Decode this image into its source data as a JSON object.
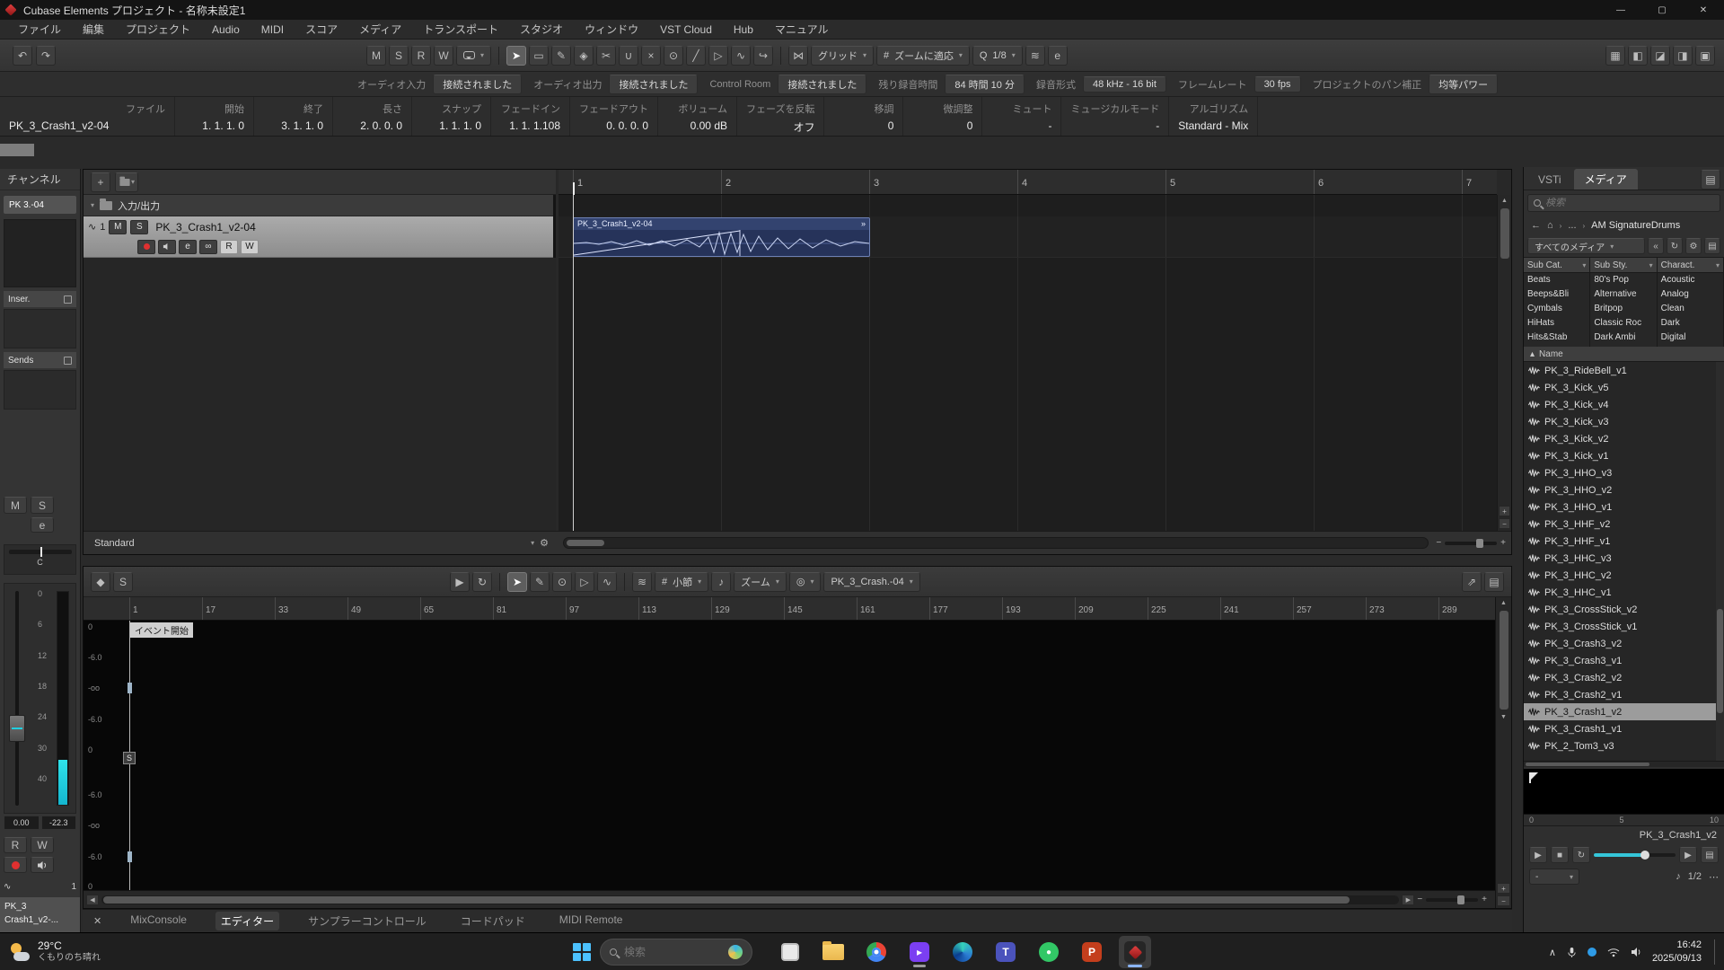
{
  "icons": {
    "caret": "▾",
    "up": "▲",
    "down": "▼",
    "left": "◀",
    "right": "▶",
    "plus": "+",
    "minus": "−",
    "undo": "↶",
    "redo": "↷",
    "close": "✕",
    "maximize": "▢",
    "minimize": "—",
    "back": "←",
    "chevron": "›",
    "ellipsis": "...",
    "home": "⌂",
    "gear": "⚙",
    "sort": "▴",
    "note": "♪",
    "play": "▶",
    "stop": "■",
    "loop": "↻",
    "menu": "▤",
    "dots": "⋯",
    "expand": "⇗",
    "grid": "▦",
    "eye": "◎",
    "hash": "#",
    "q": "Q",
    "iq": "≋",
    "e": "e",
    "pin": "◆",
    "snap": "⋈",
    "autoscroll": "↪",
    "chevup": "∧",
    "link": "∞",
    "wave": "∿",
    "rewind": "«",
    "refresh": "↻",
    "mode": "»"
  },
  "titlebar": {
    "title": "Cubase Elements プロジェクト - 名称未設定1",
    "minimize": "—",
    "maximize": "▢",
    "close": "✕"
  },
  "menubar": [
    "ファイル",
    "編集",
    "プロジェクト",
    "Audio",
    "MIDI",
    "スコア",
    "メディア",
    "トランスポート",
    "スタジオ",
    "ウィンドウ",
    "VST Cloud",
    "Hub",
    "マニュアル"
  ],
  "toolbar": {
    "state_buttons": [
      {
        "name": "mute-all-button",
        "glyph": "M"
      },
      {
        "name": "solo-all-button",
        "glyph": "S"
      },
      {
        "name": "read-automation-button",
        "glyph": "R"
      },
      {
        "name": "write-automation-button",
        "glyph": "W"
      }
    ],
    "tools": [
      {
        "name": "select-tool",
        "glyph": "➤",
        "active": true
      },
      {
        "name": "range-tool",
        "glyph": "▭"
      },
      {
        "name": "draw-tool",
        "glyph": "✎"
      },
      {
        "name": "erase-tool",
        "glyph": "◈"
      },
      {
        "name": "split-tool",
        "glyph": "✂"
      },
      {
        "name": "glue-tool",
        "glyph": "∪"
      },
      {
        "name": "mute-tool",
        "glyph": "×"
      },
      {
        "name": "zoom-tool",
        "glyph": "⊙"
      },
      {
        "name": "line-tool",
        "glyph": "╱"
      },
      {
        "name": "play-tool",
        "glyph": "▷"
      },
      {
        "name": "scrub-tool",
        "glyph": "∿"
      }
    ],
    "grid_dropdown": "グリッド",
    "grid_type_dropdown": "ズームに適応",
    "quantize_dropdown": "1/8",
    "right_icons": [
      {
        "name": "layout-grid-button",
        "glyph": "▦"
      },
      {
        "name": "left-zone-toggle",
        "glyph": "◧"
      },
      {
        "name": "lower-zone-toggle",
        "glyph": "◪"
      },
      {
        "name": "right-zone-toggle",
        "glyph": "◨"
      },
      {
        "name": "setup-layout-button",
        "glyph": "▣"
      }
    ]
  },
  "status_row": [
    {
      "label": "オーディオ入力",
      "value": "接続されました"
    },
    {
      "label": "オーディオ出力",
      "value": "接続されました"
    },
    {
      "label": "Control Room",
      "value": "接続されました"
    },
    {
      "label": "残り録音時間",
      "value": "84 時間 10 分"
    },
    {
      "label": "録音形式",
      "value": "48 kHz - 16 bit"
    },
    {
      "label": "フレームレート",
      "value": "30 fps"
    },
    {
      "label": "プロジェクトのパン補正",
      "value": "均等パワー"
    }
  ],
  "info_line": [
    {
      "label": "ファイル",
      "value": "PK_3_Crash1_v2-04"
    },
    {
      "label": "開始",
      "value": "1. 1. 1. 0"
    },
    {
      "label": "終了",
      "value": "3. 1. 1. 0"
    },
    {
      "label": "長さ",
      "value": "2. 0. 0. 0"
    },
    {
      "label": "スナップ",
      "value": "1. 1. 1. 0"
    },
    {
      "label": "フェードイン",
      "value": "1. 1. 1.108"
    },
    {
      "label": "フェードアウト",
      "value": "0. 0. 0. 0"
    },
    {
      "label": "ボリューム",
      "value": "0.00 dB"
    },
    {
      "label": "フェーズを反転",
      "value": "オフ"
    },
    {
      "label": "移調",
      "value": "0"
    },
    {
      "label": "微調整",
      "value": "0"
    },
    {
      "label": "ミュート",
      "value": "-"
    },
    {
      "label": "ミュージカルモード",
      "value": "-"
    },
    {
      "label": "アルゴリズム",
      "value": "Standard - Mix"
    }
  ],
  "channel_strip": {
    "header": "チャンネル",
    "name": "PK 3.-04",
    "inserts": "Inser.",
    "sends": "Sends",
    "mute": "M",
    "solo": "S",
    "edit": "e",
    "pan": "C",
    "scale": [
      "0",
      "6",
      "12",
      "18",
      "24",
      "30",
      "40"
    ],
    "gain": "0.00",
    "meter_peak": "-22.3",
    "read": "R",
    "write": "W",
    "count": "1",
    "bottom_line1": "PK_3",
    "bottom_line2": "Crash1_v2-..."
  },
  "project": {
    "io_label": "入力/出力",
    "track": {
      "num": "1",
      "name": "PK_3_Crash1_v2-04",
      "m": "M",
      "s": "S",
      "e": "e",
      "r": "R",
      "w": "W"
    },
    "ruler": [
      "1",
      "2",
      "3",
      "4",
      "5",
      "6",
      "7"
    ],
    "event_title": "PK_3_Crash1_v2-04",
    "footer_preset": "Standard"
  },
  "editor": {
    "solo": "S",
    "tools": [
      {
        "name": "editor-select-tool",
        "glyph": "➤",
        "active": true
      },
      {
        "name": "editor-draw-tool",
        "glyph": "✎"
      },
      {
        "name": "editor-zoom-tool",
        "glyph": "⊙"
      },
      {
        "name": "editor-play-tool",
        "glyph": "▷"
      },
      {
        "name": "editor-scrub-tool",
        "glyph": "∿"
      }
    ],
    "grid_dropdown": "小節",
    "zoom_dropdown": "ズーム",
    "clip_dropdown": "PK_3_Crash.-04",
    "ruler": [
      "1",
      "17",
      "33",
      "49",
      "65",
      "81",
      "97",
      "113",
      "129",
      "145",
      "161",
      "177",
      "193",
      "209",
      "225",
      "241",
      "257",
      "273",
      "289"
    ],
    "event_start": "イベント開始",
    "snap_marker": "S",
    "db_labels": [
      "0",
      "-6.0",
      "-oo",
      "-6.0",
      "0",
      "-6.0",
      "-oo",
      "-6.0",
      "0"
    ]
  },
  "media": {
    "tabs": [
      {
        "label": "VSTi",
        "name": "tab-vsti"
      },
      {
        "label": "メディア",
        "name": "tab-media",
        "active": true
      }
    ],
    "search_placeholder": "検索",
    "breadcrumb": "AM SignatureDrums",
    "filter_dropdown": "すべてのメディア",
    "columns": [
      {
        "header": "Sub Cat.",
        "items": [
          "Beats",
          "Beeps&Bli",
          "Cymbals",
          "HiHats",
          "Hits&Stab"
        ]
      },
      {
        "header": "Sub Sty.",
        "items": [
          "80's Pop",
          "Alternative",
          "Britpop",
          "Classic Roc",
          "Dark Ambi"
        ]
      },
      {
        "header": "Charact.",
        "items": [
          "Acoustic",
          "Analog",
          "Clean",
          "Dark",
          "Digital"
        ]
      }
    ],
    "name_header": "Name",
    "files": [
      {
        "label": "PK_3_RideBell_v1"
      },
      {
        "label": "PK_3_Kick_v5"
      },
      {
        "label": "PK_3_Kick_v4"
      },
      {
        "label": "PK_3_Kick_v3"
      },
      {
        "label": "PK_3_Kick_v2"
      },
      {
        "label": "PK_3_Kick_v1"
      },
      {
        "label": "PK_3_HHO_v3"
      },
      {
        "label": "PK_3_HHO_v2"
      },
      {
        "label": "PK_3_HHO_v1"
      },
      {
        "label": "PK_3_HHF_v2"
      },
      {
        "label": "PK_3_HHF_v1"
      },
      {
        "label": "PK_3_HHC_v3"
      },
      {
        "label": "PK_3_HHC_v2"
      },
      {
        "label": "PK_3_HHC_v1"
      },
      {
        "label": "PK_3_CrossStick_v2"
      },
      {
        "label": "PK_3_CrossStick_v1"
      },
      {
        "label": "PK_3_Crash3_v2"
      },
      {
        "label": "PK_3_Crash3_v1"
      },
      {
        "label": "PK_3_Crash2_v2"
      },
      {
        "label": "PK_3_Crash2_v1"
      },
      {
        "label": "PK_3_Crash1_v2",
        "selected": true
      },
      {
        "label": "PK_3_Crash1_v1"
      },
      {
        "label": "PK_2_Tom3_v3"
      }
    ],
    "preview_scale": {
      "start": "0",
      "mid": "5",
      "end": "10"
    },
    "preview_file": "PK_3_Crash1_v2",
    "tempo_value": "-",
    "beat_value": "1/2"
  },
  "bottom_tabs": {
    "tabs": [
      {
        "label": "MixConsole",
        "name": "tab-mixconsole"
      },
      {
        "label": "エディター",
        "name": "tab-editor",
        "active": true
      },
      {
        "label": "サンプラーコントロール",
        "name": "tab-sampler-control"
      },
      {
        "label": "コードパッド",
        "name": "tab-chord-pads"
      },
      {
        "label": "MIDI Remote",
        "name": "tab-midi-remote"
      }
    ]
  },
  "taskbar": {
    "weather_temp": "29°C",
    "weather_desc": "くもりのち晴れ",
    "search_placeholder": "検索",
    "apps": [
      "snipping-tool-icon",
      "explorer-icon",
      "chrome-icon",
      "clipchamp-icon",
      "edge-icon",
      "teams-icon",
      "line-icon",
      "powerpoint-icon",
      "cubase-taskbar-icon"
    ],
    "time": "16:42",
    "date": "2025/09/13"
  }
}
